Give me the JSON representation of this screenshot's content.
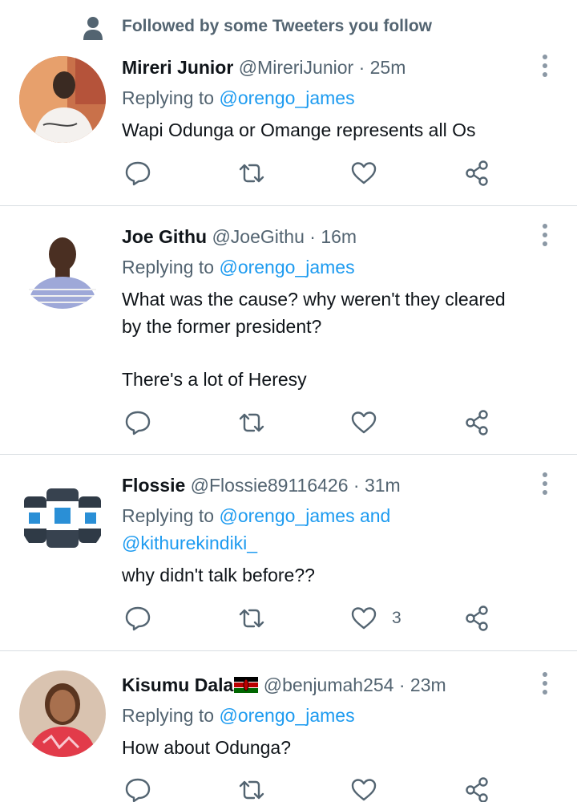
{
  "context_bar": {
    "text": "Followed by some Tweeters you follow",
    "icon": "person-icon"
  },
  "reply_prefix": "Replying to",
  "colors": {
    "accent": "#1d9bf0",
    "secondary_text": "#536471",
    "primary_text": "#0f1419",
    "divider": "#d9dee2"
  },
  "icons": {
    "reply": "comment-icon",
    "retweet": "retweet-icon",
    "like": "heart-icon",
    "share": "share-icon",
    "more": "more-vertical-icon"
  },
  "tweets": [
    {
      "name": "Mireri Junior",
      "handle": "@MireriJunior",
      "dot": "·",
      "time": "25m",
      "mention_1": "@orengo_james",
      "body": [
        "Wapi Odunga or Omange represents all Os"
      ],
      "like_count": ""
    },
    {
      "name": "Joe Githu",
      "handle": "@JoeGithu",
      "dot": "·",
      "time": "16m",
      "mention_1": "@orengo_james",
      "body": [
        "What was the cause? why weren't they cleared",
        "by the former president?",
        "There's a lot of Heresy"
      ],
      "like_count": ""
    },
    {
      "name": "Flossie",
      "handle": "@Flossie89116426",
      "dot": "·",
      "time": "31m",
      "mention_1": "@orengo_james",
      "mention_join": "and",
      "mention_2": "@kithurekindiki_",
      "body": [
        "why didn't talk before??"
      ],
      "like_count": "3"
    },
    {
      "name": "Kisumu Dala",
      "name_flag": "kenya-flag-emoji",
      "handle": "@benjumah254",
      "dot": "·",
      "time": "23m",
      "mention_1": "@orengo_james",
      "body": [
        "How about Odunga?"
      ],
      "like_count": ""
    }
  ]
}
